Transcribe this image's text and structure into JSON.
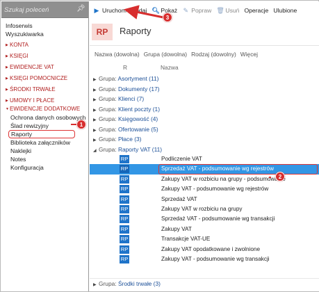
{
  "sidebar": {
    "search_placeholder": "Szukaj poleceń",
    "items": [
      {
        "label": "Infoserwis",
        "kind": "plain"
      },
      {
        "label": "Wyszukiwarka",
        "kind": "plain"
      },
      {
        "label": "KONTA",
        "kind": "group"
      },
      {
        "label": "KSIĘGI",
        "kind": "group"
      },
      {
        "label": "EWIDENCJE VAT",
        "kind": "group"
      },
      {
        "label": "KSIĘGI POMOCNICZE",
        "kind": "group"
      },
      {
        "label": "ŚRODKI TRWAŁE",
        "kind": "group"
      },
      {
        "label": "UMOWY I PŁACE",
        "kind": "group"
      },
      {
        "label": "EWIDENCJE DODATKOWE",
        "kind": "group-open"
      },
      {
        "label": "Ochrona danych osobowych",
        "kind": "child"
      },
      {
        "label": "Ślad rewizyjny",
        "kind": "child"
      },
      {
        "label": "Raporty",
        "kind": "child-selected"
      },
      {
        "label": "Biblioteka załączników",
        "kind": "child"
      },
      {
        "label": "Naklejki",
        "kind": "child"
      },
      {
        "label": "Notes",
        "kind": "child"
      },
      {
        "label": "Konfiguracja",
        "kind": "child"
      }
    ]
  },
  "toolbar": {
    "run": "Uruchom",
    "add": "Dodaj",
    "show": "Pokaż",
    "edit": "Popraw",
    "delete": "Usuń",
    "operations": "Operacje",
    "favorites": "Ulubione"
  },
  "header": {
    "logo": "RP",
    "title": "Raporty"
  },
  "filters": [
    "Nazwa (dowolna)",
    "Grupa (dowolna)",
    "Rodzaj (dowolny)",
    "Więcej"
  ],
  "columns": {
    "r": "R",
    "name": "Nazwa"
  },
  "groups_top": [
    {
      "label": "Grupa:",
      "name": "Asortyment (11)"
    },
    {
      "label": "Grupa:",
      "name": "Dokumenty (17)"
    },
    {
      "label": "Grupa:",
      "name": "Klienci (7)"
    },
    {
      "label": "Grupa:",
      "name": "Klient poczty (1)"
    },
    {
      "label": "Grupa:",
      "name": "Księgowość (4)"
    },
    {
      "label": "Grupa:",
      "name": "Ofertowanie (5)"
    },
    {
      "label": "Grupa:",
      "name": "Płace (3)"
    }
  ],
  "group_open": {
    "label": "Grupa:",
    "name": "Raporty VAT (11)"
  },
  "rows": [
    {
      "badge": "RP",
      "name": "Podliczenie VAT"
    },
    {
      "badge": "RP",
      "name": "Sprzedaż VAT - podsumowanie wg rejestrów",
      "selected": true
    },
    {
      "badge": "RP",
      "name": "Zakupy VAT w rozbiciu na grupy - podsumowanie"
    },
    {
      "badge": "RP",
      "name": "Zakupy VAT - podsumowanie wg rejestrów"
    },
    {
      "badge": "RP",
      "name": "Sprzedaż VAT"
    },
    {
      "badge": "RP",
      "name": "Zakupy VAT w rozbiciu na grupy"
    },
    {
      "badge": "RP",
      "name": "Sprzedaż VAT - podsumowanie wg transakcji"
    },
    {
      "badge": "RP",
      "name": "Zakupy VAT"
    },
    {
      "badge": "RP",
      "name": "Transakcje VAT-UE"
    },
    {
      "badge": "RP",
      "name": "Zakupy VAT opodatkowane i zwolnione"
    },
    {
      "badge": "RP",
      "name": "Zakupy VAT - podsumowanie wg transakcji"
    }
  ],
  "group_bottom": {
    "label": "Grupa:",
    "name": "Środki trwałe (3)"
  },
  "callouts": [
    "1",
    "2",
    "3"
  ],
  "colors": {
    "accent": "#1f74c9",
    "selection": "#3296e5",
    "annotation": "#d72e2e",
    "group_red": "#b01d1d"
  }
}
